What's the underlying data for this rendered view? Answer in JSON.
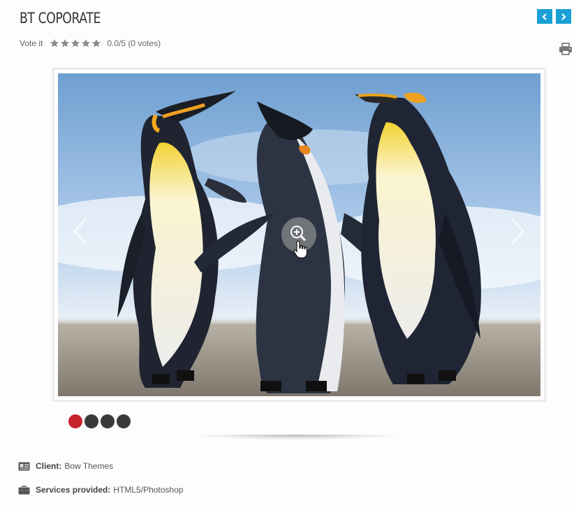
{
  "header": {
    "title": "BT COPORATE",
    "prev_icon": "chevron-left-icon",
    "next_icon": "chevron-right-icon",
    "accent_color": "#1aa0d6"
  },
  "rating": {
    "label": "Vote it",
    "stars_filled": 0,
    "stars_total": 5,
    "summary": "0.0/5 (0 votes)",
    "star_icon": "star-icon"
  },
  "toolbar": {
    "print_icon": "printer-icon"
  },
  "gallery": {
    "slide_count": 4,
    "active_slide": 1,
    "active_color": "#c8232c",
    "prev_icon": "chevron-left-icon",
    "next_icon": "chevron-right-icon",
    "zoom_icon": "zoom-in-icon"
  },
  "details": {
    "client": {
      "label": "Client:",
      "value": "Bow Themes",
      "icon": "id-card-icon"
    },
    "services": {
      "label": "Services provided:",
      "value": "HTML5/Photoshop",
      "icon": "briefcase-icon"
    }
  }
}
